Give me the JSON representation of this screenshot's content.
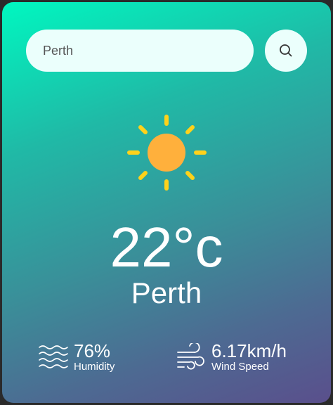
{
  "search": {
    "value": "Perth",
    "button_icon": "search-icon"
  },
  "weather": {
    "icon": "sun-icon",
    "temperature": "22°c",
    "city": "Perth"
  },
  "details": {
    "humidity": {
      "icon": "humidity-waves-icon",
      "value": "76%",
      "label": "Humidity"
    },
    "wind": {
      "icon": "wind-icon",
      "value": "6.17km/h",
      "label": "Wind Speed"
    }
  },
  "colors": {
    "gradient_start": "#00f7c0",
    "gradient_end": "#5a4f8c",
    "sun": "#ffb03c",
    "sun_rays": "#ffd21a",
    "input_bg": "#ebfffc"
  }
}
